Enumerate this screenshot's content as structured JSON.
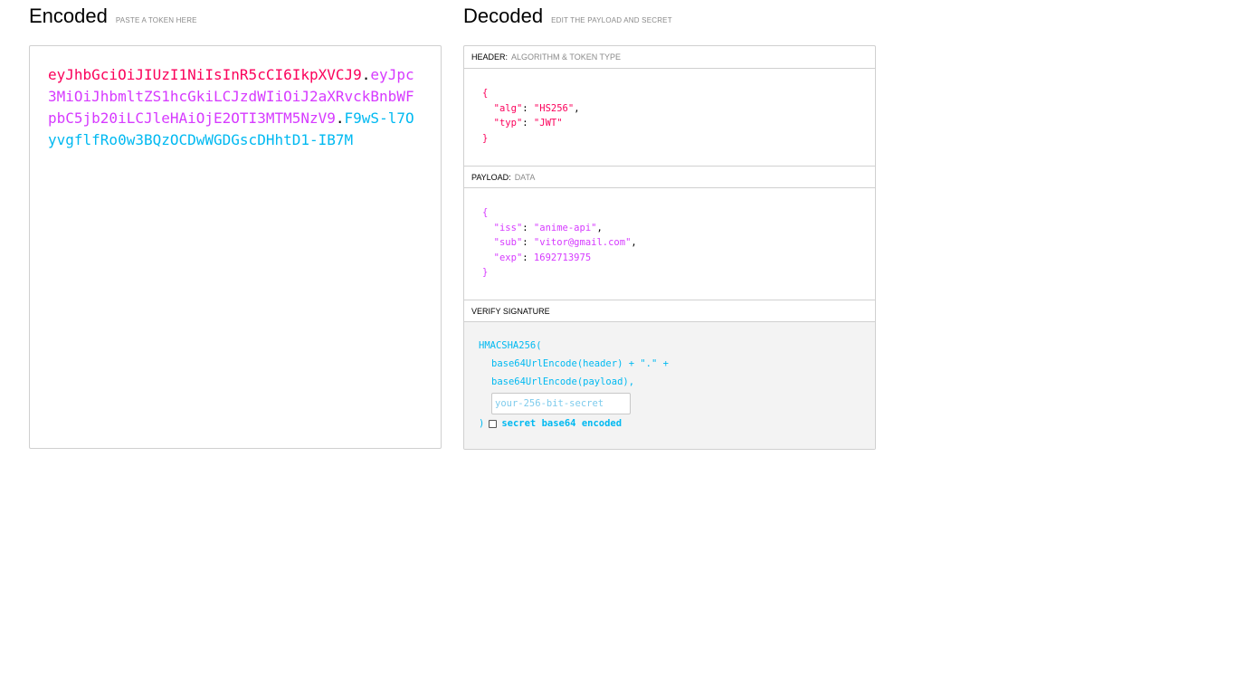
{
  "encoded": {
    "title": "Encoded",
    "subtitle": "PASTE A TOKEN HERE",
    "token": {
      "header": "eyJhbGciOiJIUzI1NiIsInR5cCI6IkpXVCJ9",
      "dot1": ".",
      "payload": "eyJpc3MiOiJhbmltZS1hcGkiLCJzdWIiOiJ2aXRvckBnbWFpbC5jb20iLCJleHAiOjE2OTI3MTM5NzV9",
      "dot2": ".",
      "signature": "F9wS-l7OyvgflfRo0w3BQzOCDwWGDGscDHhtD1-IB7M"
    }
  },
  "decoded": {
    "title": "Decoded",
    "subtitle": "EDIT THE PAYLOAD AND SECRET",
    "header_section": {
      "label": "HEADER:",
      "sub": "ALGORITHM & TOKEN TYPE",
      "open": "{",
      "close": "}",
      "fields": [
        {
          "key": "\"alg\"",
          "value": "\"HS256\"",
          "suffix": ","
        },
        {
          "key": "\"typ\"",
          "value": "\"JWT\"",
          "suffix": ""
        }
      ]
    },
    "payload_section": {
      "label": "PAYLOAD:",
      "sub": "DATA",
      "open": "{",
      "close": "}",
      "fields": [
        {
          "key": "\"iss\"",
          "value": "\"anime-api\"",
          "suffix": ","
        },
        {
          "key": "\"sub\"",
          "value": "\"vitor@gmail.com\"",
          "suffix": ","
        },
        {
          "key": "\"exp\"",
          "value": "1692713975",
          "suffix": ""
        }
      ]
    },
    "verify_section": {
      "label": "VERIFY SIGNATURE",
      "fn_open": "HMACSHA256(",
      "line1": "base64UrlEncode(header) + \".\" +",
      "line2": "base64UrlEncode(payload),",
      "secret_placeholder": "your-256-bit-secret",
      "secret_value": "",
      "close_paren": ")",
      "checkbox_label": "secret base64 encoded",
      "checkbox_checked": false
    }
  },
  "colors": {
    "header": "#fb015b",
    "payload": "#d63aff",
    "signature": "#00b9f1"
  }
}
